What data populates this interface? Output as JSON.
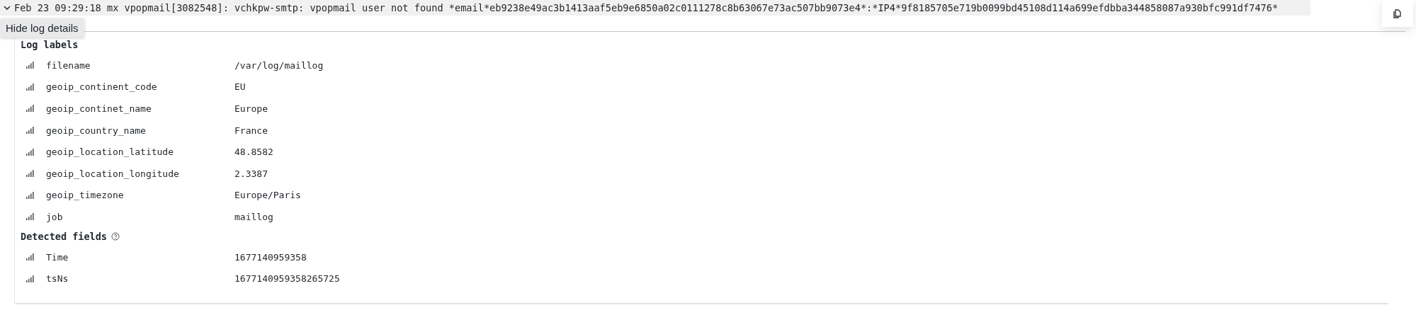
{
  "log_line": {
    "expanded": true,
    "text": "Feb 23 09:29:18 mx vpopmail[3082548]: vchkpw-smtp: vpopmail user not found *email*eb9238e49ac3b1413aaf5eb9e6850a02c0111278c8b63067e73ac507bb9073e4*:*IP4*9f8185705e719b0099bd45108d114a699efdbba344858087a930bfc991df7476*"
  },
  "tooltip": "Hide log details",
  "sections": [
    {
      "title": "Log labels",
      "info": false,
      "rows": [
        {
          "name": "filename",
          "value": "/var/log/maillog"
        },
        {
          "name": "geoip_continent_code",
          "value": "EU"
        },
        {
          "name": "geoip_continet_name",
          "value": "Europe"
        },
        {
          "name": "geoip_country_name",
          "value": "France"
        },
        {
          "name": "geoip_location_latitude",
          "value": "48.8582"
        },
        {
          "name": "geoip_location_longitude",
          "value": "2.3387"
        },
        {
          "name": "geoip_timezone",
          "value": "Europe/Paris"
        },
        {
          "name": "job",
          "value": "maillog"
        }
      ]
    },
    {
      "title": "Detected fields",
      "info": true,
      "rows": [
        {
          "name": "Time",
          "value": "1677140959358"
        },
        {
          "name": "tsNs",
          "value": "1677140959358265725"
        }
      ]
    }
  ]
}
